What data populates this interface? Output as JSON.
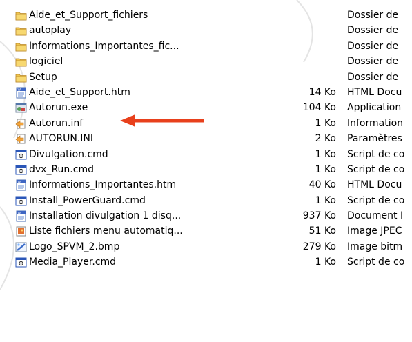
{
  "files": [
    {
      "name": "Aide_et_Support_fichiers",
      "size": "",
      "type": "Dossier de",
      "icon": "folder-icon"
    },
    {
      "name": "autoplay",
      "size": "",
      "type": "Dossier de",
      "icon": "folder-icon"
    },
    {
      "name": "Informations_Importantes_fic...",
      "size": "",
      "type": "Dossier de",
      "icon": "folder-icon"
    },
    {
      "name": "logiciel",
      "size": "",
      "type": "Dossier de",
      "icon": "folder-icon"
    },
    {
      "name": "Setup",
      "size": "",
      "type": "Dossier de",
      "icon": "folder-icon"
    },
    {
      "name": "Aide_et_Support.htm",
      "size": "14 Ko",
      "type": "HTML Docu",
      "icon": "html-document-icon"
    },
    {
      "name": "Autorun.exe",
      "size": "104 Ko",
      "type": "Application",
      "icon": "application-exe-icon"
    },
    {
      "name": "Autorun.inf",
      "size": "1 Ko",
      "type": "Information",
      "icon": "setup-information-icon"
    },
    {
      "name": "AUTORUN.INI",
      "size": "2 Ko",
      "type": "Paramètres",
      "icon": "settings-file-icon"
    },
    {
      "name": "Divulgation.cmd",
      "size": "1 Ko",
      "type": "Script de co",
      "icon": "command-script-icon"
    },
    {
      "name": "dvx_Run.cmd",
      "size": "1 Ko",
      "type": "Script de co",
      "icon": "command-script-icon"
    },
    {
      "name": "Informations_Importantes.htm",
      "size": "40 Ko",
      "type": "HTML Docu",
      "icon": "html-document-icon"
    },
    {
      "name": "Install_PowerGuard.cmd",
      "size": "1 Ko",
      "type": "Script de co",
      "icon": "command-script-icon"
    },
    {
      "name": "Installation divulgation 1 disq...",
      "size": "937 Ko",
      "type": "Document I",
      "icon": "html-document-icon"
    },
    {
      "name": "Liste fichiers menu automatiq...",
      "size": "51 Ko",
      "type": "Image JPEC",
      "icon": "jpeg-image-icon"
    },
    {
      "name": "Logo_SPVM_2.bmp",
      "size": "279 Ko",
      "type": "Image bitm",
      "icon": "bitmap-image-icon"
    },
    {
      "name": "Media_Player.cmd",
      "size": "1 Ko",
      "type": "Script de co",
      "icon": "command-script-icon"
    }
  ],
  "annotation": {
    "arrow_color": "#e8401c",
    "points_to": "Autorun.exe"
  },
  "colors": {
    "folder": "#f0c64e",
    "folder_dark": "#c9962b",
    "cmd_blue": "#2a56b8",
    "arrow": "#e8401c"
  }
}
